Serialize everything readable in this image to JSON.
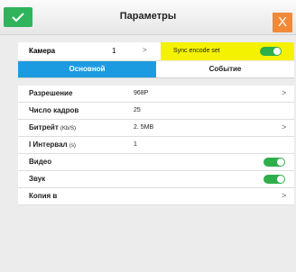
{
  "header": {
    "title": "Параметры",
    "confirm_icon": "checkmark-icon",
    "close_label": "X"
  },
  "camera": {
    "label": "Камера",
    "value": "1",
    "chevron": ">"
  },
  "sync": {
    "label": "Sync encode set",
    "enabled": true
  },
  "tabs": [
    {
      "label": "Основной",
      "active": true
    },
    {
      "label": "Событие",
      "active": false
    }
  ],
  "settings": {
    "resolution": {
      "label": "Разрешение",
      "value": "968P",
      "chevron": ">"
    },
    "framerate": {
      "label": "Число кадров",
      "value": "25"
    },
    "bitrate": {
      "label": "Битрейт",
      "unit": "(Kb/S)",
      "value": "2. 5MB",
      "chevron": ">"
    },
    "interval": {
      "label": "I Интервал",
      "unit": "(s)",
      "value": "1"
    },
    "video": {
      "label": "Видео",
      "enabled": true
    },
    "audio": {
      "label": "Звук",
      "enabled": true
    },
    "copy": {
      "label": "Копия в",
      "chevron": ">"
    }
  },
  "colors": {
    "accent": "#1d9be0",
    "confirm": "#2fb45c",
    "close": "#f08a3a",
    "sync_highlight": "#f4f200",
    "toggle_on": "#2fae4c"
  }
}
